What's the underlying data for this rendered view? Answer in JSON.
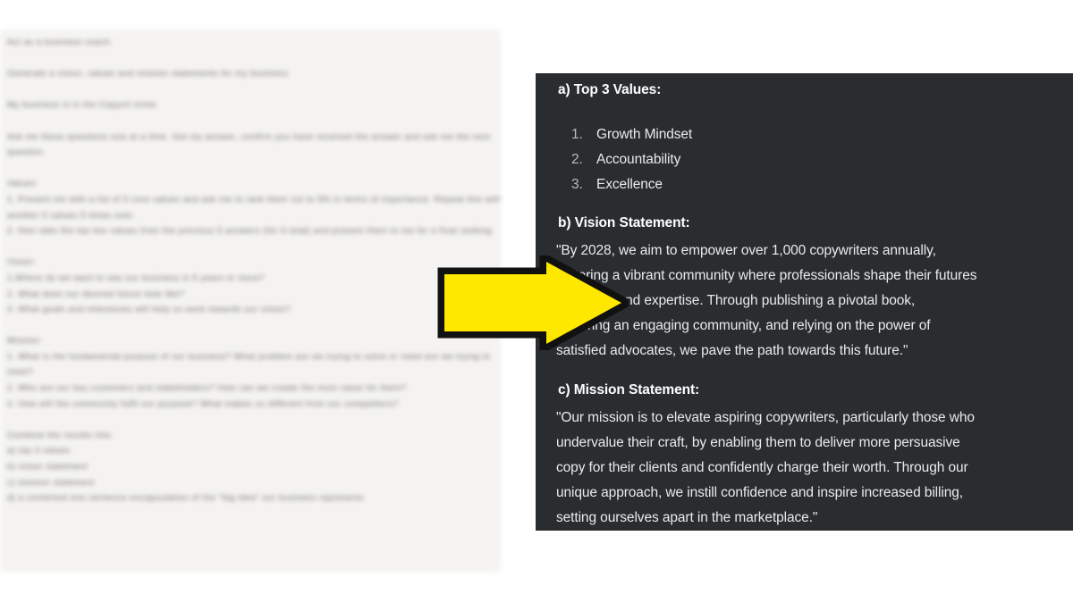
{
  "colors": {
    "dark_panel_bg": "#2a2d30",
    "prompt_panel_bg": "#f4f3f0",
    "page_bg": "#ffffff",
    "arrow_fill": "#ffe800",
    "arrow_outline": "#111111",
    "heading_text": "#ffffff",
    "body_text": "#e9eaeb",
    "list_number": "#b9bcbe"
  },
  "prompt_panel": {
    "text": "Act as a business coach.\n\nGenerate a vision, values and mission statements for my business.\n\nMy business is in the Copycil niche.\n\nAsk me these questions one at a time. Get my answer, confirm you have received the answer and ask me the next question.\n\nValues:\n1. Present me with a list of 5 core values and ask me to rank them 1st to 5th in terms of importance. Repeat this with another 5 values 5 times over.\n2. then take the top two values from the previous 5 answers (for 6 total) and present them to me for a final ranking.\n\nVision:\n1.Where do we want to see our business in 5 years or more?\n2. What does our desired future look like?\n3. What goals and milestones will help us work towards our vision?\n\nMission:\n1. What is the fundamental purpose of our business? What problem are we trying to solve or need are we trying to meet?\n2. Who are our key customers and stakeholders? How can we create the most value for them?\n3. How will the community fulfil our purpose? What makes us different from our competitors?\n\nCombine the results into:\na) top 3 values\nb) vision statement\nc) mission statement\nd) a combined one sentence encapsulation of the \"big idea\" our business represents"
  },
  "answer_panel": {
    "values_section": {
      "heading": "a) Top 3 Values:",
      "items": [
        "Growth Mindset",
        "Accountability",
        "Excellence"
      ]
    },
    "vision_section": {
      "heading": "b) Vision Statement:",
      "lines": [
        "\"By 2028, we aim to empower over 1,000 copywriters annually,",
        "fostering a vibrant community where professionals shape their futures",
        "with skills and expertise. Through publishing a pivotal book,",
        "nurturing an engaging community, and relying on the power of",
        "satisfied advocates, we pave the path towards this future.\""
      ]
    },
    "mission_section": {
      "heading": "c) Mission Statement:",
      "lines": [
        "\"Our mission is to elevate aspiring copywriters, particularly those who",
        "undervalue their craft, by enabling them to deliver more persuasive",
        "copy for their clients and confidently charge their worth. Through our",
        "unique approach, we instill confidence and inspire increased billing,",
        "setting ourselves apart in the marketplace.\""
      ]
    }
  },
  "annotation": {
    "arrow": {
      "icon": "right-arrow-icon",
      "direction": "right"
    }
  }
}
